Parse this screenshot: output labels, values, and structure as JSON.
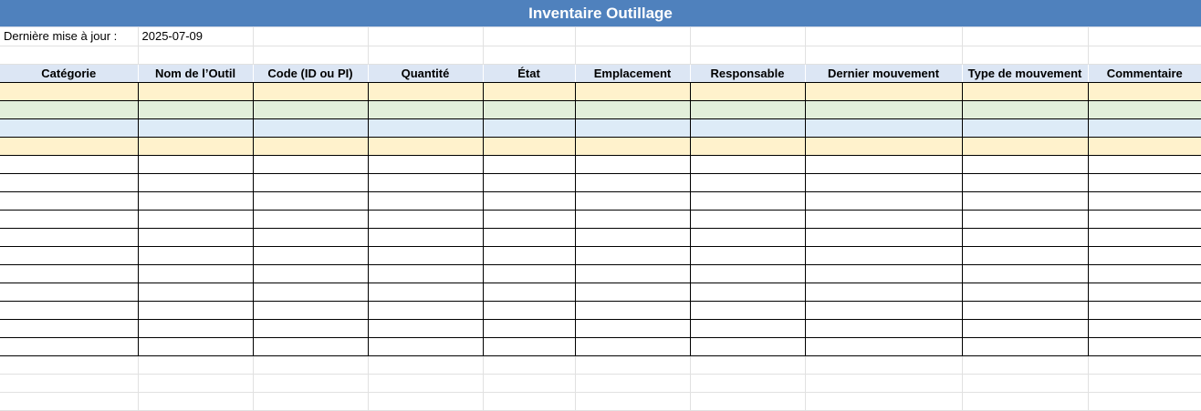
{
  "sheet": {
    "title": "Inventaire Outillage",
    "last_update_label": "Dernière mise à jour :",
    "last_update_value": "2025-07-09"
  },
  "table": {
    "columns": [
      "Catégorie",
      "Nom de l’Outil",
      "Code (ID ou PI)",
      "Quantité",
      "État",
      "Emplacement",
      "Responsable",
      "Dernier mouvement",
      "Type de mouvement",
      "Commentaire"
    ],
    "row_fill_colors": [
      "#fff2cc",
      "#e2efda",
      "#ddebf7",
      "#fff2cc"
    ],
    "header_fill": "#dce6f4",
    "title_fill": "#4f81bd"
  }
}
